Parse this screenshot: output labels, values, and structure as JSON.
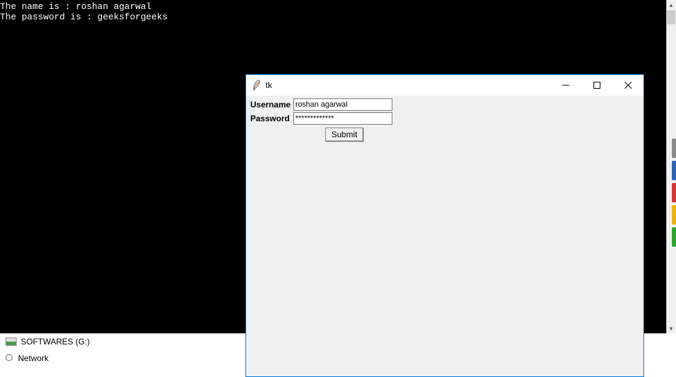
{
  "console": {
    "line1": "The name is : roshan agarwal",
    "line2": "The password is : geeksforgeeks"
  },
  "desktop": {
    "softwares_label": "SOFTWARES (G:)",
    "network_label": "Network"
  },
  "tk": {
    "title": "tk",
    "username_label": "Username",
    "password_label": "Password",
    "username_value": "roshan agarwal",
    "password_value": "*************",
    "submit_label": "Submit"
  },
  "edge_colors": {
    "c1": "#8a8a8a",
    "c2": "#2c64b8",
    "c3": "#d63838",
    "c4": "#f2b200",
    "c5": "#2ca82c"
  }
}
